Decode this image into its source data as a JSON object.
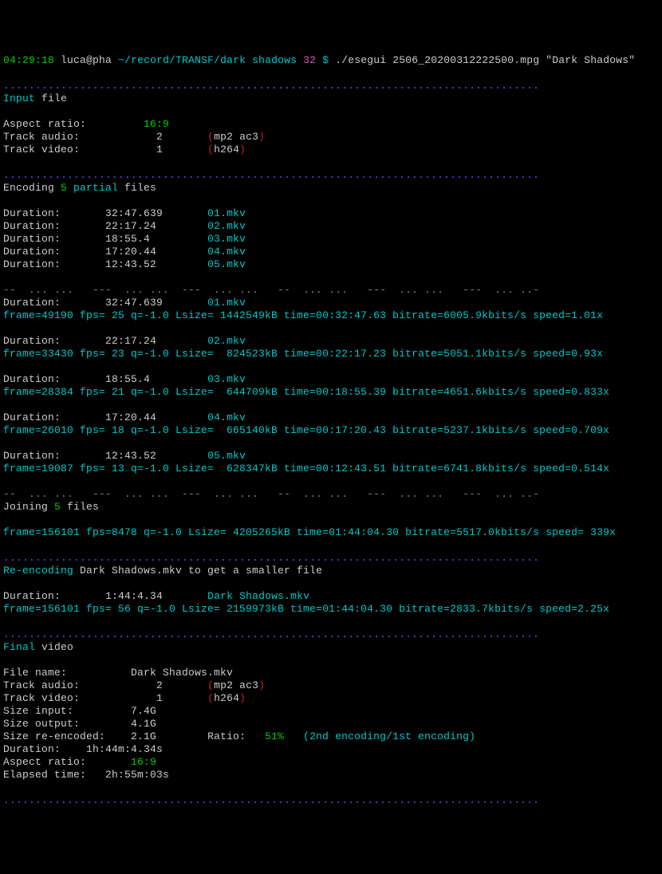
{
  "prompt": {
    "time": "04:29:18",
    "userhost": "luca@pha",
    "path": "~/record/TRANSF/dark shadows",
    "dircount": "32",
    "dollar": "$",
    "cmd": "./esegui 2506_20200312222500.mpg \"Dark Shadows\""
  },
  "sep_dots": "....................................................................................",
  "sep_dashes": "--  ... ...   ---  ... ...  ---  ... ...   --  ... ...   ---  ... ...   ---  ... ..-",
  "input_hdr": {
    "a": "Input",
    "b": " file"
  },
  "input": {
    "aspect_label": "Aspect ratio:",
    "aspect": "16:9",
    "taudio_label": "Track audio:",
    "taudio_n": "2",
    "taudio_open": "(",
    "taudio_codecs": "mp2 ac3",
    "taudio_close": ")",
    "tvideo_label": "Track video:",
    "tvideo_n": "1",
    "tvideo_open": "(",
    "tvideo_codec": "h264",
    "tvideo_close": ")"
  },
  "enc_hdr": {
    "a": "Encoding ",
    "n": "5",
    "b": " partial",
    "c": " files"
  },
  "parts": [
    {
      "lbl": "Duration:",
      "dur": "32:47.639",
      "file": "01.mkv"
    },
    {
      "lbl": "Duration:",
      "dur": "22:17.24",
      "file": "02.mkv"
    },
    {
      "lbl": "Duration:",
      "dur": "18:55.4",
      "file": "03.mkv"
    },
    {
      "lbl": "Duration:",
      "dur": "17:20.44",
      "file": "04.mkv"
    },
    {
      "lbl": "Duration:",
      "dur": "12:43.52",
      "file": "05.mkv"
    }
  ],
  "runs": [
    {
      "lbl": "Duration:",
      "dur": "32:47.639",
      "file": "01.mkv",
      "stat": "frame=49190 fps= 25 q=-1.0 Lsize= 1442549kB time=00:32:47.63 bitrate=6005.9kbits/s speed=1.01x"
    },
    {
      "lbl": "Duration:",
      "dur": "22:17.24",
      "file": "02.mkv",
      "stat": "frame=33430 fps= 23 q=-1.0 Lsize=  824523kB time=00:22:17.23 bitrate=5051.1kbits/s speed=0.93x"
    },
    {
      "lbl": "Duration:",
      "dur": "18:55.4",
      "file": "03.mkv",
      "stat": "frame=28384 fps= 21 q=-1.0 Lsize=  644709kB time=00:18:55.39 bitrate=4651.6kbits/s speed=0.833x"
    },
    {
      "lbl": "Duration:",
      "dur": "17:20.44",
      "file": "04.mkv",
      "stat": "frame=26010 fps= 18 q=-1.0 Lsize=  665140kB time=00:17:20.43 bitrate=5237.1kbits/s speed=0.709x"
    },
    {
      "lbl": "Duration:",
      "dur": "12:43.52",
      "file": "05.mkv",
      "stat": "frame=19087 fps= 13 q=-1.0 Lsize=  628347kB time=00:12:43.51 bitrate=6741.8kbits/s speed=0.514x"
    }
  ],
  "join_hdr": {
    "a": "Joining ",
    "n": "5",
    "b": " files"
  },
  "join_stat": "frame=156101 fps=8478 q=-1.0 Lsize= 4205265kB time=01:44:04.30 bitrate=5517.0kbits/s speed= 339x",
  "reenc_hdr": {
    "a": "Re-encoding ",
    "b": "Dark Shadows.mkv to get a smaller file"
  },
  "reenc": {
    "lbl": "Duration:",
    "dur": "1:44:4.34",
    "file": "Dark Shadows.mkv",
    "stat": "frame=156101 fps= 56 q=-1.0 Lsize= 2159973kB time=01:44:04.30 bitrate=2833.7kbits/s speed=2.25x"
  },
  "final_hdr": {
    "a": "Final",
    "b": " video"
  },
  "final": {
    "fname_lbl": "File name:",
    "fname": "Dark Shadows.mkv",
    "taudio_lbl": "Track audio:",
    "taudio_n": "2",
    "taudio_open": "(",
    "taudio_codecs": "mp2 ac3",
    "taudio_close": ")",
    "tvideo_lbl": "Track video:",
    "tvideo_n": "1",
    "tvideo_open": "(",
    "tvideo_codec": "h264",
    "tvideo_close": ")",
    "sin_lbl": "Size input:",
    "sin": "7.4G",
    "sout_lbl": "Size output:",
    "sout": "4.1G",
    "sre_lbl": "Size re-encoded:",
    "sre": "2.1G",
    "ratio_lbl": "Ratio:",
    "ratio": "51%",
    "ratio_note": "(2nd encoding/1st encoding)",
    "dur_lbl": "Duration:",
    "dur": "1h:44m:4.34s",
    "asp_lbl": "Aspect ratio:",
    "asp": "16:9",
    "elap_lbl": "Elapsed time:",
    "elap": "2h:55m:03s"
  }
}
